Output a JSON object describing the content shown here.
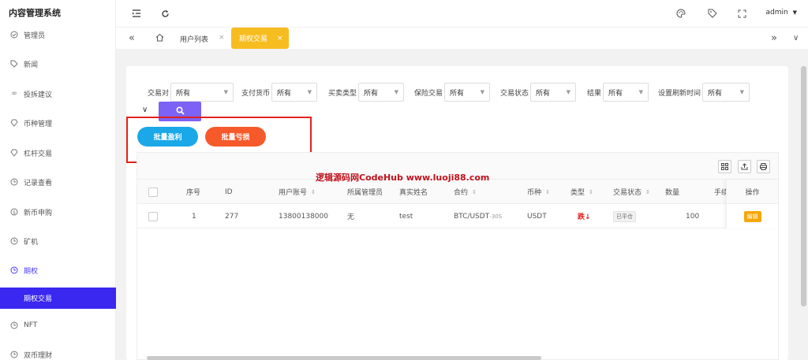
{
  "app": {
    "title": "内容管理系统"
  },
  "sidebar": {
    "items": [
      {
        "label": "管理员",
        "icon": "shield-icon",
        "glyph": "⊙"
      },
      {
        "label": "新闻",
        "icon": "tag-icon",
        "glyph": "◇"
      },
      {
        "label": "投拆建议",
        "icon": "link-icon",
        "glyph": "∞"
      },
      {
        "label": "币种管理",
        "icon": "diamond-icon",
        "glyph": "◈"
      },
      {
        "label": "杠杆交易",
        "icon": "diamond-icon",
        "glyph": "◈"
      },
      {
        "label": "记录查看",
        "icon": "clock-icon",
        "glyph": "◷"
      },
      {
        "label": "新币申购",
        "icon": "coin-icon",
        "glyph": "$"
      },
      {
        "label": "矿机",
        "icon": "clock-icon",
        "glyph": "◷"
      },
      {
        "label": "期权",
        "icon": "clock-icon",
        "glyph": "◷"
      },
      {
        "label": "期权交易",
        "icon": "",
        "glyph": ""
      },
      {
        "label": "NFT",
        "icon": "clock-icon",
        "glyph": "◷"
      },
      {
        "label": "双币理财",
        "icon": "clock-icon",
        "glyph": "◷"
      }
    ]
  },
  "header": {
    "user": "admin"
  },
  "tabs": {
    "plain": "用户列表",
    "plain_close": "×",
    "active": "期权交易",
    "active_close": "×"
  },
  "filters": [
    {
      "label": "交易对",
      "value": "所有"
    },
    {
      "label": "支付货币",
      "value": "所有"
    },
    {
      "label": "买卖类型",
      "value": "所有"
    },
    {
      "label": "保险交易",
      "value": "所有"
    },
    {
      "label": "交易状态",
      "value": "所有"
    },
    {
      "label": "结果",
      "value": "所有"
    },
    {
      "label": "设置刷新时间",
      "value": "所有"
    }
  ],
  "actions": {
    "profit": "批量盈利",
    "loss": "批量亏损"
  },
  "watermark": "逻辑源码网CodeHub www.luoji88.com",
  "table": {
    "columns": [
      "序号",
      "ID",
      "用户账号",
      "所属管理员",
      "真实姓名",
      "合约",
      "币种",
      "类型",
      "交易状态",
      "数量",
      "手续"
    ],
    "ops_header": "操作",
    "rows": [
      {
        "index": "1",
        "id": "277",
        "account": "13800138000",
        "admin": "无",
        "realname": "test",
        "contract": "BTC/USDT",
        "contract_suffix": "-30S",
        "currency": "USDT",
        "type": "跌↓",
        "status": "已平仓",
        "amount": "100",
        "fee": "",
        "op": "编辑"
      }
    ]
  },
  "colors": {
    "accent": "#3a27f0",
    "profit": "#1aa8e8",
    "loss": "#f65a2a",
    "tab": "#f7bd20",
    "search": "#7c63f5"
  }
}
